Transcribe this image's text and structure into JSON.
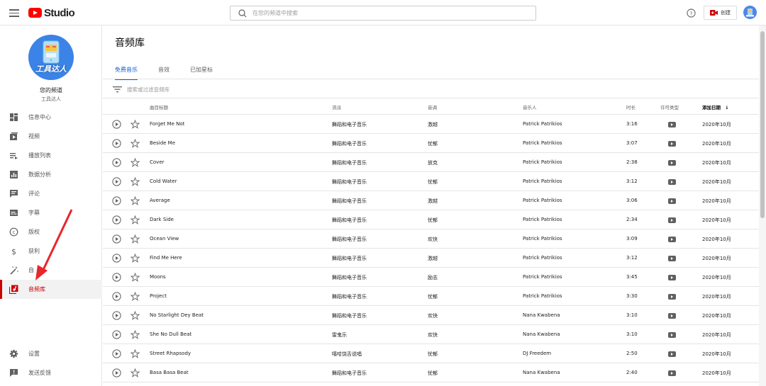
{
  "app": {
    "logo_text": "Studio"
  },
  "search": {
    "placeholder": "在您的频道中搜索"
  },
  "header": {
    "create_label": "创建"
  },
  "channel": {
    "title": "您的频道",
    "subtitle": "工具达人",
    "avatar_text": "工具达人"
  },
  "sidebar": {
    "items": [
      {
        "label": "信息中心",
        "icon": "dashboard-icon"
      },
      {
        "label": "视频",
        "icon": "video-icon"
      },
      {
        "label": "播放列表",
        "icon": "playlist-icon"
      },
      {
        "label": "数据分析",
        "icon": "analytics-icon"
      },
      {
        "label": "评论",
        "icon": "comment-icon"
      },
      {
        "label": "字幕",
        "icon": "subtitles-icon"
      },
      {
        "label": "版权",
        "icon": "copyright-icon"
      },
      {
        "label": "获利",
        "icon": "dollar-icon"
      },
      {
        "label": "自",
        "icon": "magic-wand-icon"
      },
      {
        "label": "音频库",
        "icon": "audio-library-icon",
        "active": true
      }
    ],
    "bottom": [
      {
        "label": "设置",
        "icon": "gear-icon"
      },
      {
        "label": "发送反馈",
        "icon": "feedback-icon"
      }
    ]
  },
  "main": {
    "title": "音频库",
    "tabs": [
      "免费音乐",
      "音效",
      "已加星标"
    ],
    "filter_placeholder": "搜索或过滤音频库",
    "columns": [
      "曲目标题",
      "流派",
      "音调",
      "音乐人",
      "时长",
      "许可类型",
      "添加日期"
    ],
    "sort_arrow": "↓",
    "rows": [
      [
        "Forget Me Not",
        "舞蹈和电子音乐",
        "激越",
        "Patrick Patrikios",
        "3:16",
        "2020年10月"
      ],
      [
        "Beside Me",
        "舞蹈和电子音乐",
        "忧郁",
        "Patrick Patrikios",
        "3:07",
        "2020年10月"
      ],
      [
        "Cover",
        "舞蹈和电子音乐",
        "放克",
        "Patrick Patrikios",
        "2:38",
        "2020年10月"
      ],
      [
        "Cold Water",
        "舞蹈和电子音乐",
        "忧郁",
        "Patrick Patrikios",
        "3:12",
        "2020年10月"
      ],
      [
        "Average",
        "舞蹈和电子音乐",
        "激越",
        "Patrick Patrikios",
        "3:06",
        "2020年10月"
      ],
      [
        "Dark Side",
        "舞蹈和电子音乐",
        "忧郁",
        "Patrick Patrikios",
        "2:34",
        "2020年10月"
      ],
      [
        "Ocean View",
        "舞蹈和电子音乐",
        "欢快",
        "Patrick Patrikios",
        "3:09",
        "2020年10月"
      ],
      [
        "Find Me Here",
        "舞蹈和电子音乐",
        "激越",
        "Patrick Patrikios",
        "3:12",
        "2020年10月"
      ],
      [
        "Moons",
        "舞蹈和电子音乐",
        "励志",
        "Patrick Patrikios",
        "3:45",
        "2020年10月"
      ],
      [
        "Project",
        "舞蹈和电子音乐",
        "忧郁",
        "Patrick Patrikios",
        "3:30",
        "2020年10月"
      ],
      [
        "No Starlight Dey Beat",
        "舞蹈和电子音乐",
        "欢快",
        "Nana Kwabena",
        "3:10",
        "2020年10月"
      ],
      [
        "She No Dull Beat",
        "雷鬼乐",
        "欢快",
        "Nana Kwabena",
        "3:10",
        "2020年10月"
      ],
      [
        "Street Rhapsody",
        "嘻哈饶舌说唱",
        "忧郁",
        "DJ Freedem",
        "2:50",
        "2020年10月"
      ],
      [
        "Basa Basa Beat",
        "舞蹈和电子音乐",
        "忧郁",
        "Nana Kwabena",
        "2:40",
        "2020年10月"
      ]
    ]
  },
  "colors": {
    "brand_red": "#ff0000",
    "active_red": "#cc0000",
    "tab_blue": "#065fd4",
    "annotation_arrow": "#e8262b"
  }
}
